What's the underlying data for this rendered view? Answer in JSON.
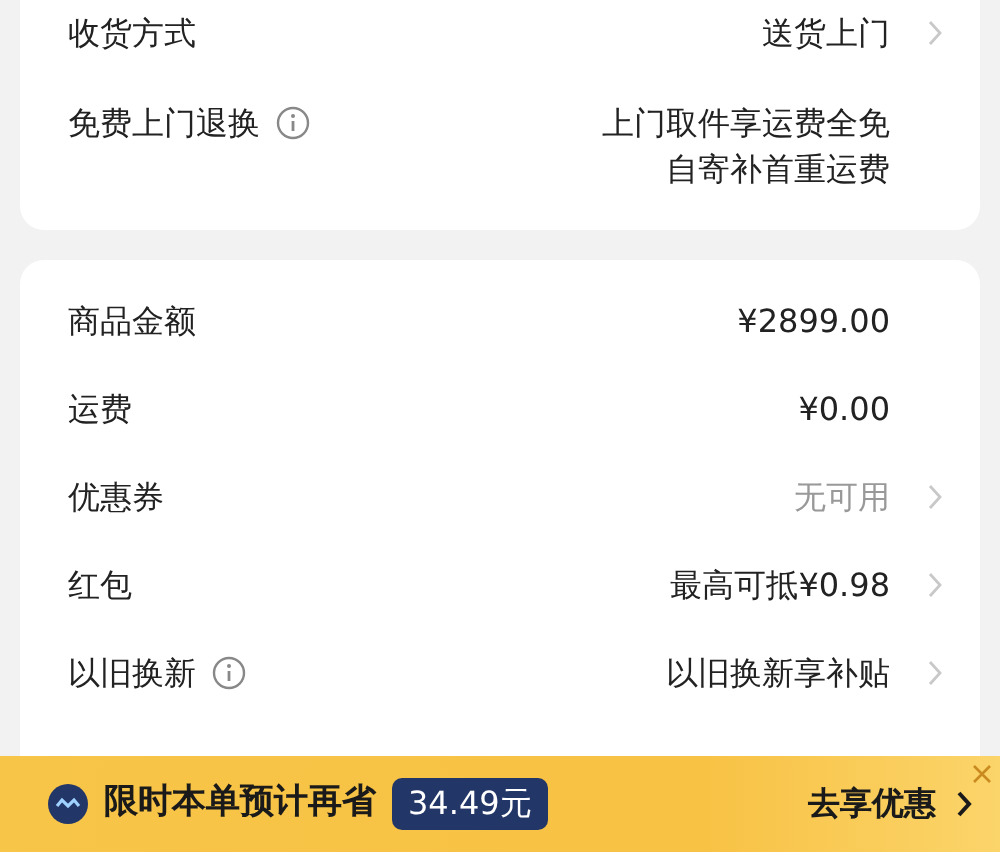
{
  "cards": [
    {
      "rows": [
        {
          "label": "收货方式",
          "values": [
            "送货上门"
          ],
          "chevron": true
        },
        {
          "label": "免费上门退换",
          "info": true,
          "values": [
            "上门取件享运费全免",
            "自寄补首重运费"
          ]
        }
      ]
    },
    {
      "rows": [
        {
          "label": "商品金额",
          "values": [
            "¥2899.00"
          ]
        },
        {
          "label": "运费",
          "values": [
            "¥0.00"
          ]
        },
        {
          "label": "优惠券",
          "values": [
            "无可用"
          ],
          "muted": true,
          "chevron": true
        },
        {
          "label": "红包",
          "values": [
            "最高可抵¥0.98"
          ],
          "chevron": true
        },
        {
          "label": "以旧换新",
          "info": true,
          "values": [
            "以旧换新享补贴"
          ],
          "chevron": true
        }
      ]
    }
  ],
  "promo_banner": {
    "text": "限时本单预计再省",
    "amount": "34.49元",
    "action": "去享优惠",
    "closable": true
  }
}
